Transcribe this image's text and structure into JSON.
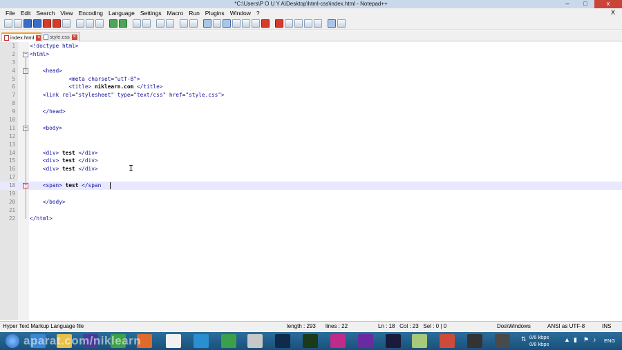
{
  "window": {
    "title": "*C:\\Users\\P O U Y A\\Desktop\\html-css\\index.html - Notepad++",
    "controls": {
      "minimize": "–",
      "maximize": "□",
      "close": "x"
    }
  },
  "menu": {
    "items": [
      "File",
      "Edit",
      "Search",
      "View",
      "Encoding",
      "Language",
      "Settings",
      "Macro",
      "Run",
      "Plugins",
      "Window",
      "?"
    ],
    "close_label": "X"
  },
  "tabs": [
    {
      "label": "index.html",
      "active": true
    },
    {
      "label": "style.css",
      "active": false
    }
  ],
  "editor": {
    "current_line": 18,
    "lines": [
      {
        "n": "1",
        "text": "<!doctype html>"
      },
      {
        "n": "2",
        "text": "<html>"
      },
      {
        "n": "3",
        "text": ""
      },
      {
        "n": "4",
        "text": "    <head>"
      },
      {
        "n": "5",
        "text": "            <meta charset=\"utf-8\">"
      },
      {
        "n": "6",
        "text": "            <title> niklearn.com </title>"
      },
      {
        "n": "7",
        "text": "    <link rel=\"stylesheet\" type=\"text/css\" href=\"style.css\">"
      },
      {
        "n": "8",
        "text": ""
      },
      {
        "n": "9",
        "text": "    </head>"
      },
      {
        "n": "10",
        "text": ""
      },
      {
        "n": "11",
        "text": "    <body>"
      },
      {
        "n": "12",
        "text": ""
      },
      {
        "n": "13",
        "text": ""
      },
      {
        "n": "14",
        "text": "    <div> test </div>"
      },
      {
        "n": "15",
        "text": "    <div> test </div>"
      },
      {
        "n": "16",
        "text": "    <div> test </div>"
      },
      {
        "n": "17",
        "text": ""
      },
      {
        "n": "18",
        "text": "    <span> test </span"
      },
      {
        "n": "19",
        "text": ""
      },
      {
        "n": "20",
        "text": "    </body>"
      },
      {
        "n": "21",
        "text": ""
      },
      {
        "n": "22",
        "text": "</html>"
      }
    ]
  },
  "statusbar": {
    "file_type": "Hyper Text Markup Language file",
    "length": "length : 293",
    "lines": "lines : 22",
    "position": "Ln : 18   Col : 23   Sel : 0 | 0",
    "eol": "Dos\\Windows",
    "encoding": "ANSI as UTF-8",
    "mode": "INS"
  },
  "taskbar": {
    "watermark": "aparat.com/niklearn",
    "net_up": "0/6 kbps",
    "net_down": "0/8 kbps",
    "language": "ENG"
  },
  "colors": {
    "tag": "#1010a0",
    "attribute": "#c80000",
    "value": "#8000ff",
    "current_line": "#e8e8ff",
    "tab_accent": "#f0a030"
  }
}
